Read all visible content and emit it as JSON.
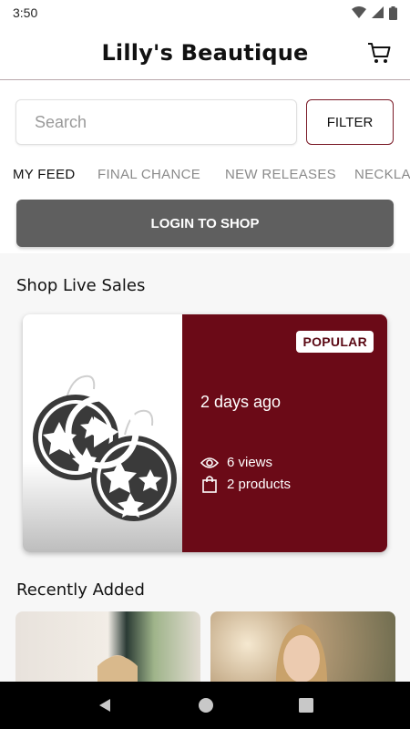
{
  "status": {
    "time": "3:50"
  },
  "header": {
    "title": "Lilly's Beautique"
  },
  "search": {
    "placeholder": "Search",
    "filter_label": "FILTER"
  },
  "tabs": [
    {
      "label": "MY FEED"
    },
    {
      "label": "FINAL CHANCE"
    },
    {
      "label": "NEW RELEASES"
    },
    {
      "label": "NECKLA"
    }
  ],
  "login": {
    "label": "LOGIN TO SHOP"
  },
  "live": {
    "section_title": "Shop Live Sales",
    "badge": "POPULAR",
    "time_ago": "2 days ago",
    "views": "6 views",
    "products": "2 products"
  },
  "recent": {
    "section_title": "Recently Added"
  },
  "colors": {
    "brand": "#6b0a17",
    "login_bg": "#5f5f5f",
    "nav_bar": "#000000"
  },
  "icons": [
    "wifi-icon",
    "signal-icon",
    "battery-icon",
    "cart-icon",
    "play-icon",
    "eye-icon",
    "bag-icon",
    "back-icon",
    "home-icon",
    "recents-icon"
  ]
}
